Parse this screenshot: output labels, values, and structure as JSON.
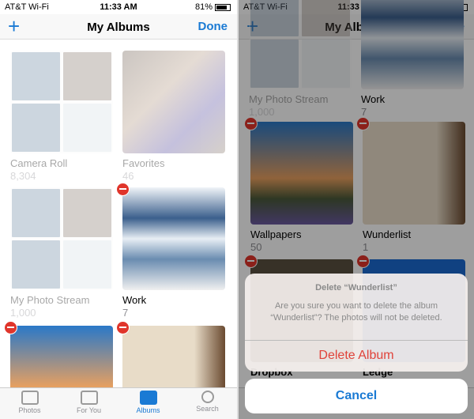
{
  "status": {
    "carrier": "AT&T Wi-Fi",
    "time": "11:33 AM",
    "battery": "81%",
    "battery_level": 0.81
  },
  "nav": {
    "add_icon": "+",
    "title": "My Albums",
    "done": "Done"
  },
  "albums": [
    {
      "name": "Camera Roll",
      "count": "8,304"
    },
    {
      "name": "Favorites",
      "count": "46"
    },
    {
      "name": "My Photo Stream",
      "count": "1,000"
    },
    {
      "name": "Work",
      "count": "7"
    },
    {
      "name": "Wallpapers",
      "count": "50"
    },
    {
      "name": "Wunderlist",
      "count": "1"
    },
    {
      "name": "Dropbox",
      "count": ""
    },
    {
      "name": "Ledge",
      "count": ""
    }
  ],
  "tabs": [
    {
      "label": "Photos"
    },
    {
      "label": "For You"
    },
    {
      "label": "Albums",
      "active": true
    },
    {
      "label": "Search"
    }
  ],
  "dialog": {
    "title": "Delete “Wunderlist”",
    "message": "Are you sure you want to delete the album “Wunderlist”? The photos will not be deleted.",
    "delete": "Delete Album",
    "cancel": "Cancel"
  },
  "colors": {
    "accent": "#1a7ad4",
    "destructive": "#e0352b"
  }
}
